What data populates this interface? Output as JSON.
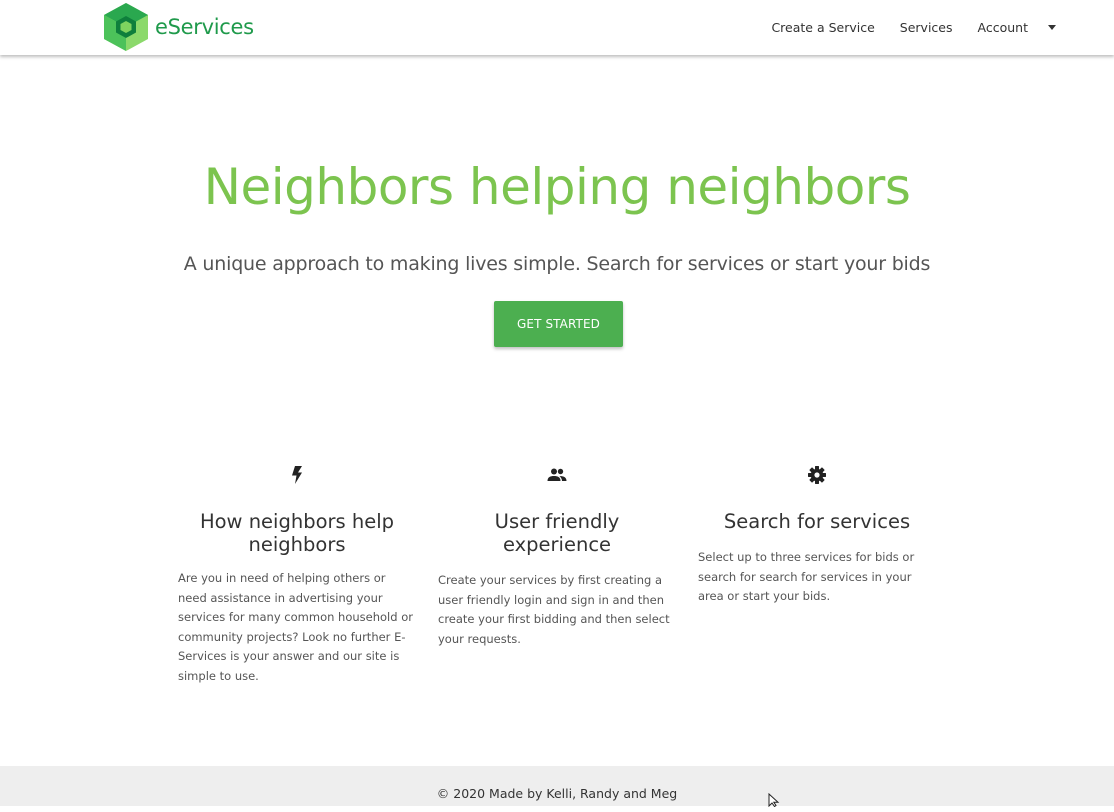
{
  "navbar": {
    "brand": {
      "name": "eServices",
      "logo_icon": "hexagon-e-logo-icon"
    },
    "links": [
      {
        "label": "Create a Service"
      },
      {
        "label": "Services"
      },
      {
        "label": "Account"
      }
    ],
    "account_caret_icon": "caret-down-icon"
  },
  "hero": {
    "title": "Neighbors helping neighbors",
    "subtitle": "A unique approach to making lives simple. Search for services or start your bids",
    "cta_label": "GET STARTED"
  },
  "features": [
    {
      "icon": "flash-icon",
      "title": "How neighbors help neighbors",
      "text": "Are you in need of helping others or need assistance in advertising your services for many common household or community projects? Look no further E-Services is your answer and our site is simple to use."
    },
    {
      "icon": "group-icon",
      "title": "User friendly experience",
      "text": "Create your services by first creating a user friendly login and sign in and then create your first bidding and then select your requests."
    },
    {
      "icon": "settings-gear-icon",
      "title": "Search for services",
      "text": "Select up to three services for bids or search for search for services in your area or start your bids."
    }
  ],
  "footer": {
    "text": "© 2020 Made by Kelli, Randy and Meg"
  },
  "colors": {
    "brand_green": "#1f9a4b",
    "hero_title": "#7cc44f",
    "button_green": "#4caf50",
    "footer_bg": "#eeeeee"
  }
}
